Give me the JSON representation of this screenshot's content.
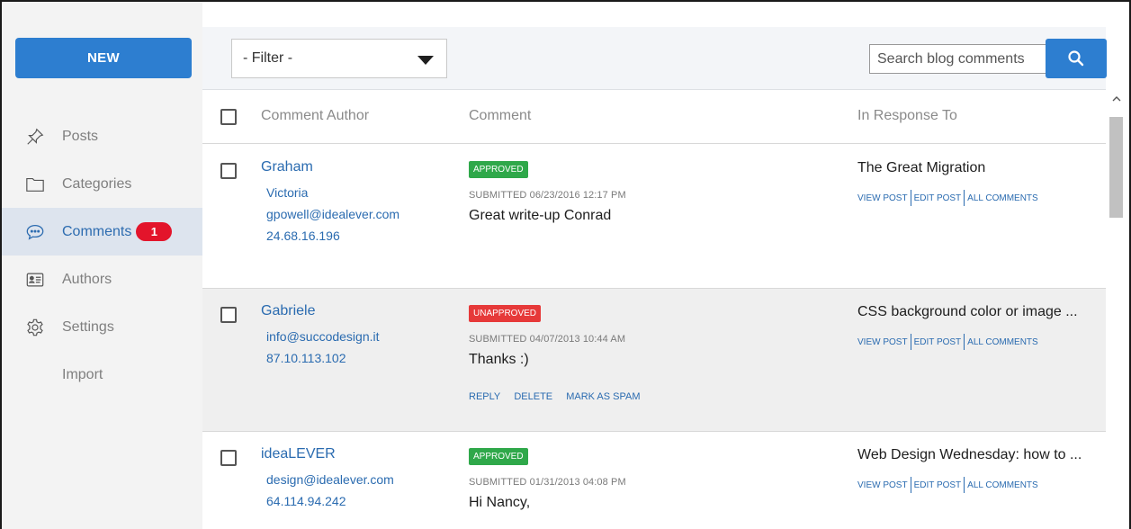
{
  "sidebar": {
    "new_label": "NEW",
    "items": [
      {
        "label": "Posts",
        "icon": "pin-icon"
      },
      {
        "label": "Categories",
        "icon": "folder-icon"
      },
      {
        "label": "Comments",
        "icon": "comment-icon",
        "badge": "1",
        "active": true
      },
      {
        "label": "Authors",
        "icon": "id-card-icon"
      },
      {
        "label": "Settings",
        "icon": "gear-icon"
      },
      {
        "label": "Import"
      }
    ]
  },
  "toolbar": {
    "filter_label": "- Filter -",
    "search_placeholder": "Search blog comments"
  },
  "table": {
    "headers": [
      "Comment Author",
      "Comment",
      "In Response To"
    ],
    "rows": [
      {
        "author": "Graham",
        "meta": [
          "Victoria",
          "gpowell@idealever.com",
          "24.68.16.196"
        ],
        "status": "APPROVED",
        "submitted": "SUBMITTED 06/23/2016 12:17 PM",
        "comment": "Great write-up Conrad",
        "post_title": "The Great Migration",
        "post_links": [
          "VIEW POST",
          "EDIT POST",
          "ALL COMMENTS"
        ]
      },
      {
        "author": "Gabriele",
        "meta": [
          "info@succodesign.it",
          "87.10.113.102"
        ],
        "status": "UNAPPROVED",
        "submitted": "SUBMITTED 04/07/2013 10:44 AM",
        "comment": "Thanks :)",
        "actions": [
          "REPLY",
          "DELETE",
          "MARK AS SPAM"
        ],
        "post_title": "CSS background color or image ...",
        "post_links": [
          "VIEW POST",
          "EDIT POST",
          "ALL COMMENTS"
        ]
      },
      {
        "author": "ideaLEVER",
        "meta": [
          "design@idealever.com",
          "64.114.94.242"
        ],
        "status": "APPROVED",
        "submitted": "SUBMITTED 01/31/2013 04:08 PM",
        "comment": "Hi Nancy,",
        "post_title": "Web Design Wednesday: how to ...",
        "post_links": [
          "VIEW POST",
          "EDIT POST",
          "ALL COMMENTS"
        ]
      }
    ]
  },
  "colors": {
    "accent": "#2d7ed0",
    "link": "#2a6bb0",
    "approved": "#2fa84a",
    "unapproved": "#e63939",
    "badge": "#e3142b"
  }
}
